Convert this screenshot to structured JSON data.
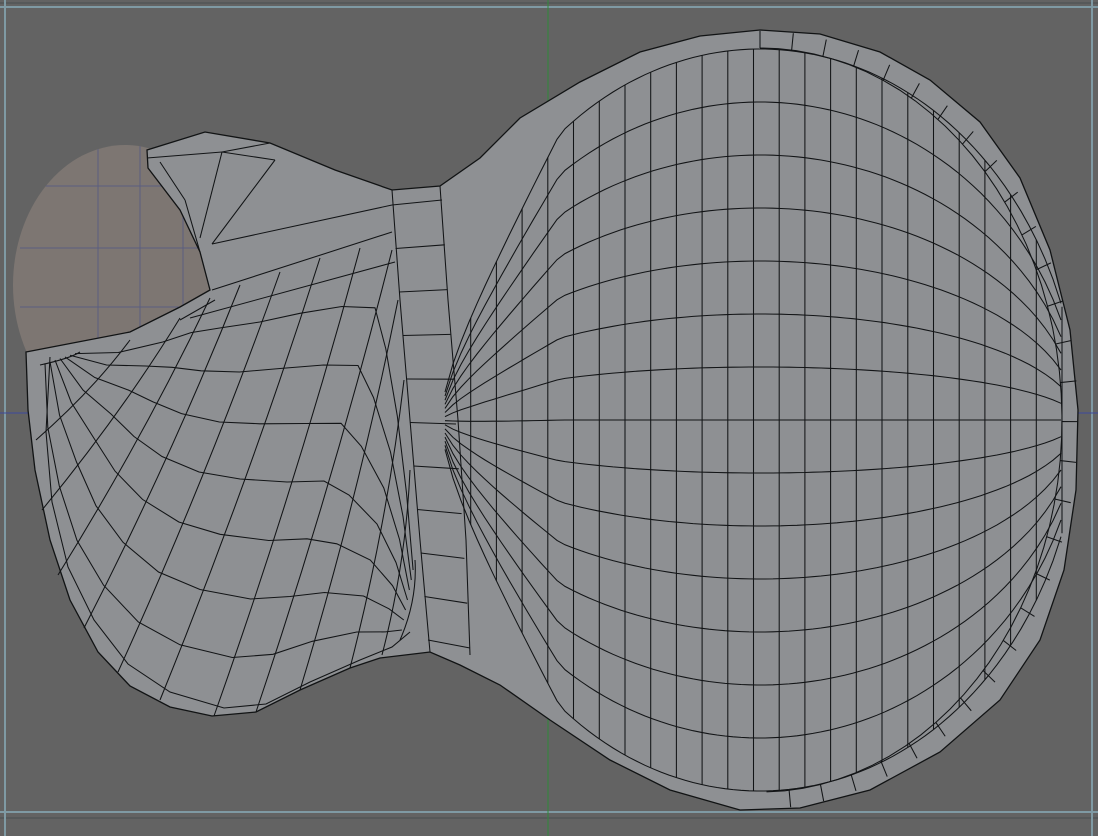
{
  "viewport": {
    "background_color": "#636363",
    "mesh_color": "#8e9093",
    "wire_color": "#141618",
    "reference_image_color": "#7d7672",
    "axis_colors": {
      "vertical": "#2f8a3a",
      "horizontal": "#3c4a9c",
      "frame": "#7f9aa4"
    }
  },
  "mesh": {
    "object": "guitar-body",
    "shading": "flat-wireframe",
    "segments": {
      "rings": 3,
      "body_columns": 24,
      "lower_horn_columns": 13
    }
  }
}
